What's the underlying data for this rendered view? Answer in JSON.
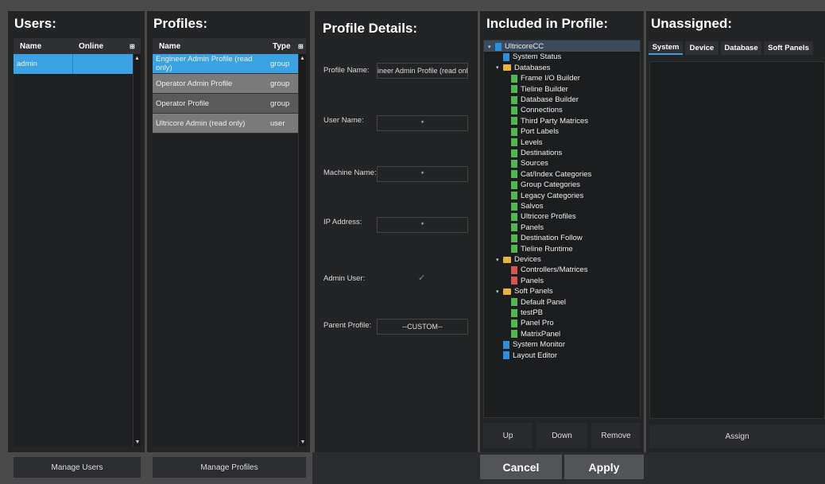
{
  "users": {
    "title": "Users:",
    "col_name": "Name",
    "col_online": "Online",
    "rows": [
      {
        "name": "admin",
        "online": ""
      }
    ],
    "manage": "Manage Users"
  },
  "profiles": {
    "title": "Profiles:",
    "col_name": "Name",
    "col_type": "Type",
    "rows": [
      {
        "name": "Engineer Admin Profile (read only)",
        "type": "group"
      },
      {
        "name": "Operator Admin Profile",
        "type": "group"
      },
      {
        "name": "Operator Profile",
        "type": "group"
      },
      {
        "name": "Ultricore Admin (read only)",
        "type": "user"
      }
    ],
    "manage": "Manage Profiles"
  },
  "details": {
    "title": "Profile Details:",
    "profile_name_label": "Profile Name:",
    "profile_name_value": "gineer Admin Profile (read only",
    "user_name_label": "User Name:",
    "user_name_value": "*",
    "machine_name_label": "Machine Name:",
    "machine_name_value": "*",
    "ip_label": "IP Address:",
    "ip_value": "*",
    "admin_label": "Admin User:",
    "parent_label": "Parent Profile:",
    "parent_value": "--CUSTOM--"
  },
  "included": {
    "title": "Included in Profile:",
    "tree": [
      {
        "label": "UltricoreCC",
        "icon": "db-icon",
        "color": "blue",
        "depth": 0,
        "arrow": "▾"
      },
      {
        "label": "System Status",
        "icon": "doc-icon",
        "color": "blue",
        "depth": 1
      },
      {
        "label": "Databases",
        "icon": "folder-icon",
        "color": "folder",
        "depth": 1,
        "arrow": "▾"
      },
      {
        "label": "Frame I/O Builder",
        "icon": "doc-icon",
        "color": "green",
        "depth": 2
      },
      {
        "label": "Tieline Builder",
        "icon": "doc-icon",
        "color": "green",
        "depth": 2
      },
      {
        "label": "Database Builder",
        "icon": "doc-icon",
        "color": "green",
        "depth": 2
      },
      {
        "label": "Connections",
        "icon": "doc-icon",
        "color": "green",
        "depth": 2
      },
      {
        "label": "Third Party Matrices",
        "icon": "doc-icon",
        "color": "green",
        "depth": 2
      },
      {
        "label": "Port Labels",
        "icon": "doc-icon",
        "color": "green",
        "depth": 2
      },
      {
        "label": "Levels",
        "icon": "doc-icon",
        "color": "green",
        "depth": 2
      },
      {
        "label": "Destinations",
        "icon": "doc-icon",
        "color": "green",
        "depth": 2
      },
      {
        "label": "Sources",
        "icon": "doc-icon",
        "color": "green",
        "depth": 2
      },
      {
        "label": "Cat/Index Categories",
        "icon": "doc-icon",
        "color": "green",
        "depth": 2
      },
      {
        "label": "Group Categories",
        "icon": "doc-icon",
        "color": "green",
        "depth": 2
      },
      {
        "label": "Legacy Categories",
        "icon": "doc-icon",
        "color": "green",
        "depth": 2
      },
      {
        "label": "Salvos",
        "icon": "doc-icon",
        "color": "green",
        "depth": 2
      },
      {
        "label": "Ultricore Profiles",
        "icon": "doc-icon",
        "color": "green",
        "depth": 2
      },
      {
        "label": "Panels",
        "icon": "doc-icon",
        "color": "green",
        "depth": 2
      },
      {
        "label": "Destination Follow",
        "icon": "doc-icon",
        "color": "green",
        "depth": 2
      },
      {
        "label": "Tieline Runtime",
        "icon": "doc-icon",
        "color": "green",
        "depth": 2
      },
      {
        "label": "Devices",
        "icon": "folder-icon",
        "color": "folder",
        "depth": 1,
        "arrow": "▾"
      },
      {
        "label": "Controllers/Matrices",
        "icon": "doc-icon",
        "color": "red",
        "depth": 2
      },
      {
        "label": "Panels",
        "icon": "doc-icon",
        "color": "red",
        "depth": 2
      },
      {
        "label": "Soft Panels",
        "icon": "folder-icon",
        "color": "folder",
        "depth": 1,
        "arrow": "▾"
      },
      {
        "label": "Default Panel",
        "icon": "doc-icon",
        "color": "green",
        "depth": 2
      },
      {
        "label": "testPB",
        "icon": "doc-icon",
        "color": "green",
        "depth": 2
      },
      {
        "label": "Panel Pro",
        "icon": "doc-icon",
        "color": "green",
        "depth": 2
      },
      {
        "label": "MatrixPanel",
        "icon": "doc-icon",
        "color": "green",
        "depth": 2
      },
      {
        "label": "System Monitor",
        "icon": "doc-icon",
        "color": "blue",
        "depth": 1
      },
      {
        "label": "Layout Editor",
        "icon": "doc-icon",
        "color": "blue",
        "depth": 1
      }
    ],
    "up": "Up",
    "down": "Down",
    "remove": "Remove"
  },
  "unassigned": {
    "title": "Unassigned:",
    "tabs": [
      "System",
      "Device",
      "Database",
      "Soft Panels"
    ],
    "assign": "Assign"
  },
  "footer": {
    "cancel": "Cancel",
    "apply": "Apply"
  },
  "colors": {
    "selected": "#3ba2e4",
    "row_light": "#7a7a7a",
    "row_dark": "#5a5a5a"
  }
}
